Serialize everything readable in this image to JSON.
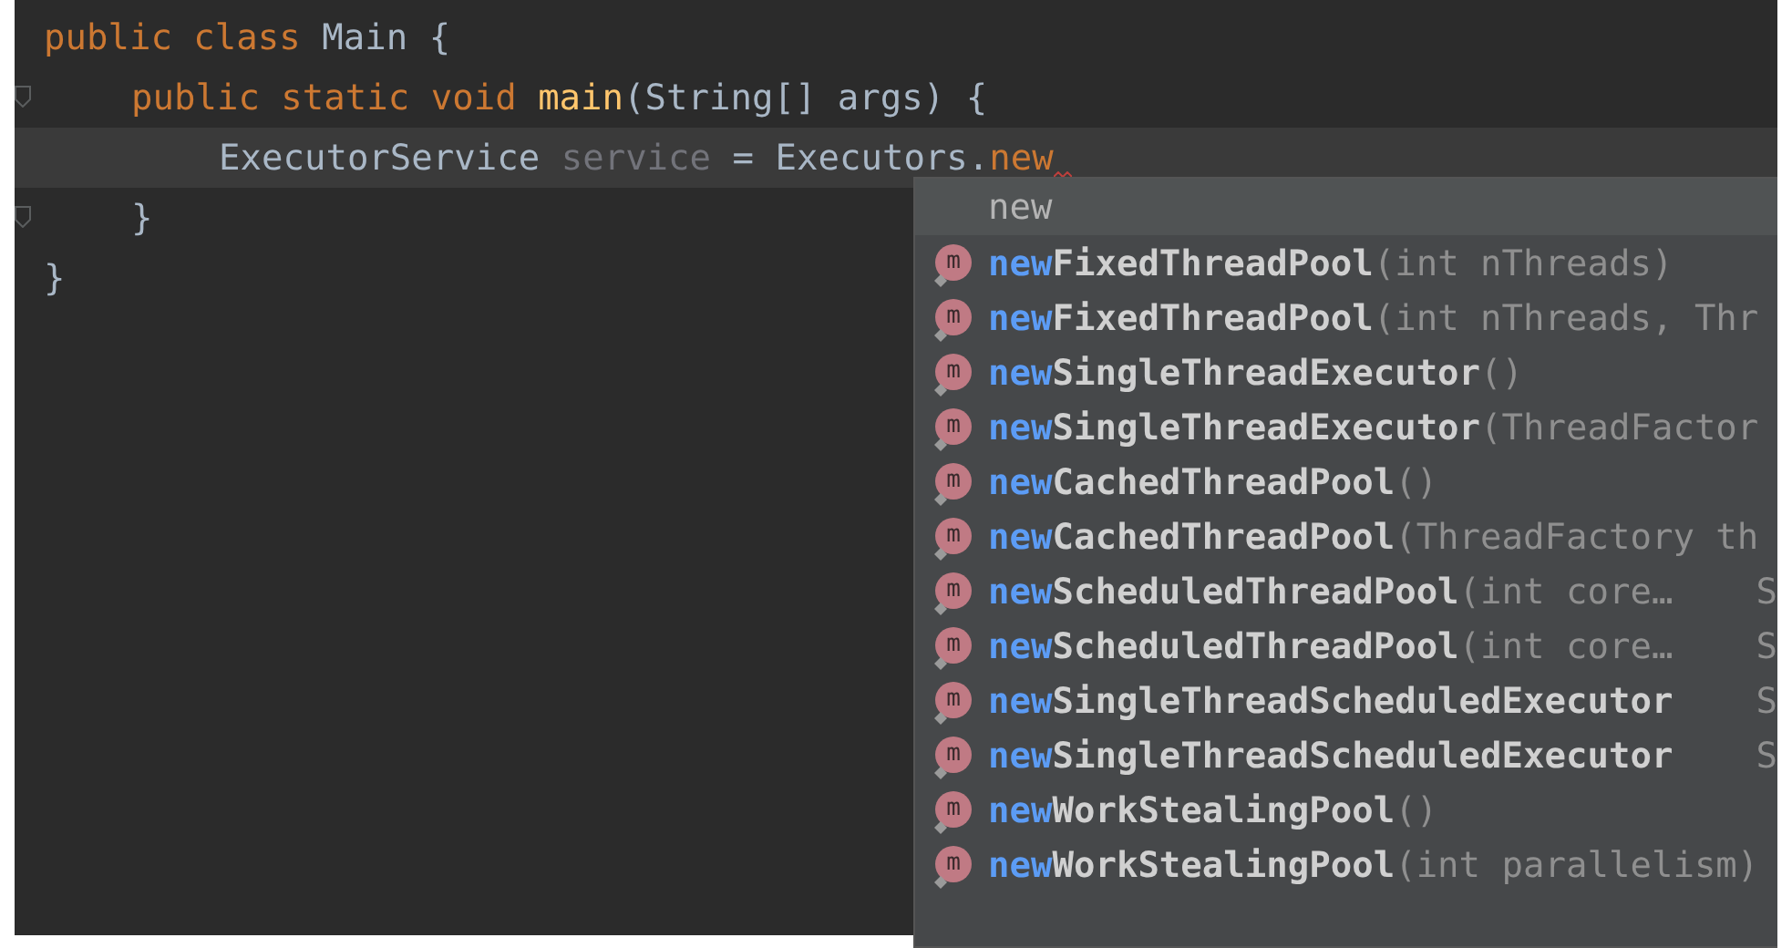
{
  "code": [
    {
      "current": false,
      "fold": false,
      "tokens": [
        {
          "kind": "keyword",
          "text": "public class"
        },
        {
          "kind": "plain",
          "text": " Main {"
        }
      ],
      "children": [
        {
          "current": false,
          "fold": true,
          "tokens": [
            {
              "kind": "keyword",
              "text": "public static void"
            },
            {
              "kind": "method",
              "text": " main"
            },
            {
              "kind": "plain",
              "text": "(String[] args) {"
            }
          ],
          "children": [
            {
              "current": true,
              "fold": false,
              "tokens": [
                {
                  "kind": "plain",
                  "text": "ExecutorService"
                },
                {
                  "kind": "unused",
                  "text": " service"
                },
                {
                  "kind": "plain",
                  "text": " = Executors."
                },
                {
                  "kind": "error",
                  "text": "new"
                }
              ]
            }
          ]
        },
        {
          "current": false,
          "fold": true,
          "tokens": [
            {
              "kind": "plain",
              "text": "}"
            }
          ]
        }
      ]
    },
    {
      "current": false,
      "fold": false,
      "tokens": [
        {
          "kind": "plain",
          "text": "}"
        }
      ]
    }
  ],
  "completion": {
    "query": "new",
    "items": [
      {
        "icon": "m",
        "prefix": "new",
        "name": "FixedThreadPool",
        "params": "(int nThreads)"
      },
      {
        "icon": "m",
        "prefix": "new",
        "name": "FixedThreadPool",
        "params": "(int nThreads, Thr"
      },
      {
        "icon": "m",
        "prefix": "new",
        "name": "SingleThreadExecutor",
        "params": "()"
      },
      {
        "icon": "m",
        "prefix": "new",
        "name": "SingleThreadExecutor",
        "params": "(ThreadFactor"
      },
      {
        "icon": "m",
        "prefix": "new",
        "name": "CachedThreadPool",
        "params": "()"
      },
      {
        "icon": "m",
        "prefix": "new",
        "name": "CachedThreadPool",
        "params": "(ThreadFactory th"
      },
      {
        "icon": "m",
        "prefix": "new",
        "name": "ScheduledThreadPool",
        "params": "(int core…",
        "type": "S"
      },
      {
        "icon": "m",
        "prefix": "new",
        "name": "ScheduledThreadPool",
        "params": "(int core…",
        "type": "S"
      },
      {
        "icon": "m",
        "prefix": "new",
        "name": "SingleThreadScheduledExecutor",
        "type": "S"
      },
      {
        "icon": "m",
        "prefix": "new",
        "name": "SingleThreadScheduledExecutor",
        "type": "S"
      },
      {
        "icon": "m",
        "prefix": "new",
        "name": "WorkStealingPool",
        "params": "()"
      },
      {
        "icon": "m",
        "prefix": "new",
        "name": "WorkStealingPool",
        "params": "(int parallelism)"
      }
    ]
  }
}
